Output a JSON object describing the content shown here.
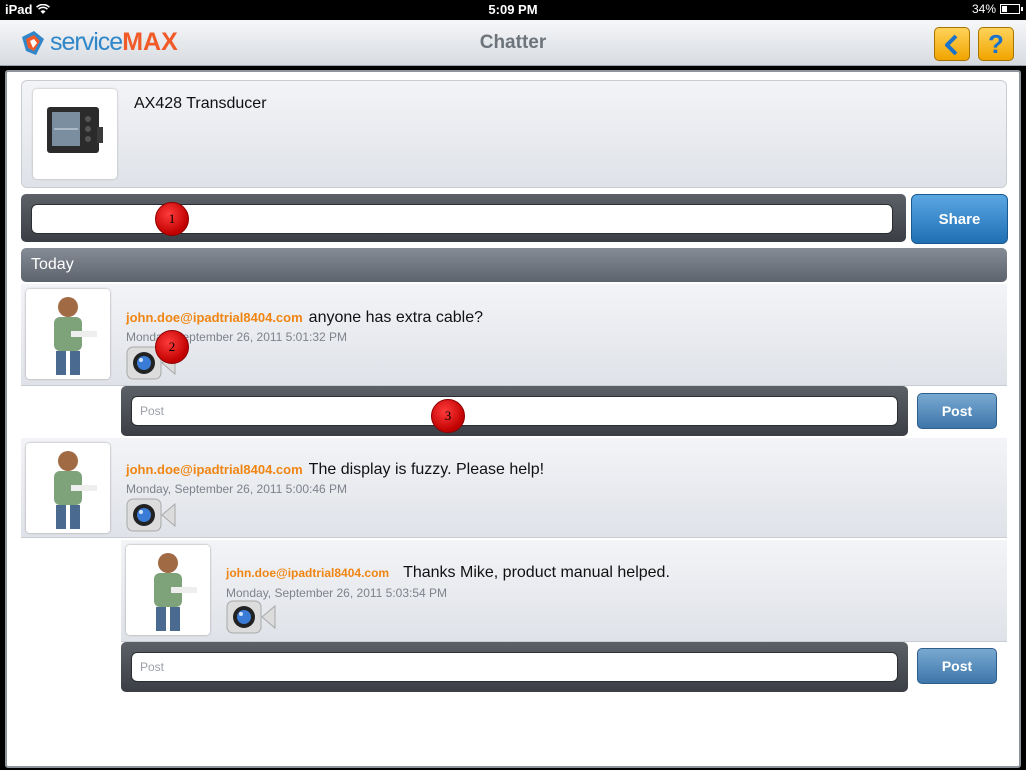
{
  "status_bar": {
    "device": "iPad",
    "time": "5:09 PM",
    "battery_text": "34%",
    "battery_level": 0.34
  },
  "nav": {
    "logo_service": "service",
    "logo_max": "MAX",
    "title": "Chatter",
    "back_icon": "back-arrow-icon",
    "help_label": "?"
  },
  "product": {
    "title": "AX428 Transducer",
    "thumb_icon": "device-image"
  },
  "share": {
    "input_value": "",
    "button_label": "Share"
  },
  "section": {
    "header": "Today"
  },
  "posts": [
    {
      "author": "john.doe@ipadtrial8404.com",
      "message": "anyone has extra cable?",
      "timestamp": "Monday, September 26, 2011 5:01:32 PM",
      "reply_placeholder": "Post",
      "post_label": "Post"
    },
    {
      "author": "john.doe@ipadtrial8404.com",
      "message": "The display is fuzzy. Please help!",
      "timestamp": "Monday, September 26, 2011 5:00:46 PM",
      "replies": [
        {
          "author": "john.doe@ipadtrial8404.com",
          "message": "Thanks Mike, product manual helped.",
          "timestamp": "Monday, September 26, 2011 5:03:54 PM"
        }
      ],
      "reply_placeholder": "Post",
      "post_label": "Post"
    }
  ],
  "markers": [
    "1",
    "2",
    "3"
  ],
  "colors": {
    "accent_orange": "#f08512",
    "brand_blue": "#2f87c9",
    "brand_orange": "#f05a28",
    "share_blue": "#1f6fb4"
  }
}
